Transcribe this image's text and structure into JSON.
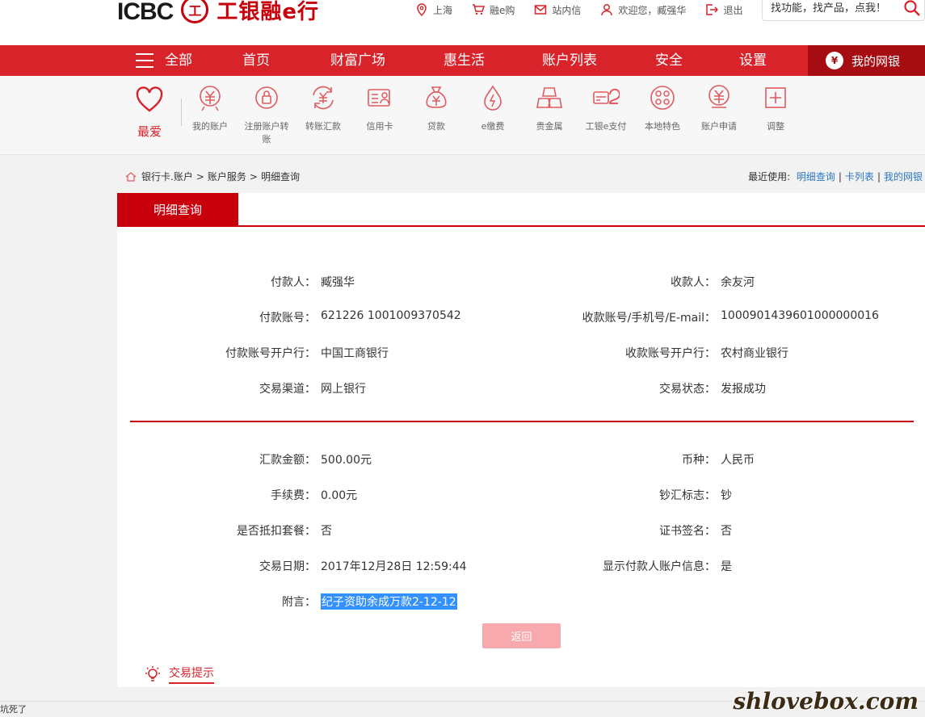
{
  "header": {
    "logo_text": "ICBC",
    "logo_seal": "工",
    "logo_cn": "工银融e行",
    "links": [
      {
        "label": "上海",
        "icon": "location-pin-icon"
      },
      {
        "label": "融e购",
        "icon": "cart-icon"
      },
      {
        "label": "站内信",
        "icon": "mail-icon"
      },
      {
        "label": "欢迎您，臧强华",
        "icon": "user-icon"
      },
      {
        "label": "退出",
        "icon": "logout-icon"
      }
    ],
    "search_placeholder": "找功能，找产品，点我！"
  },
  "nav": {
    "all_label": "全部",
    "items": [
      "首页",
      "财富广场",
      "惠生活",
      "账户列表",
      "安全",
      "设置"
    ],
    "mybank_label": "我的网银"
  },
  "quickbar": {
    "favorite_label": "最爱",
    "items": [
      {
        "label": "我的账户",
        "icon": "yen-circle-icon"
      },
      {
        "label": "注册账户转账",
        "icon": "lock-circle-icon"
      },
      {
        "label": "转账汇款",
        "icon": "transfer-icon"
      },
      {
        "label": "信用卡",
        "icon": "credit-card-icon"
      },
      {
        "label": "贷款",
        "icon": "money-bag-icon"
      },
      {
        "label": "e缴费",
        "icon": "flame-drop-icon"
      },
      {
        "label": "贵金属",
        "icon": "gold-bars-icon"
      },
      {
        "label": "工银e支付",
        "icon": "e-pay-icon"
      },
      {
        "label": "本地特色",
        "icon": "local-icon"
      },
      {
        "label": "账户申请",
        "icon": "apply-icon"
      },
      {
        "label": "调整",
        "icon": "plus-box-icon"
      }
    ]
  },
  "breadcrumb": {
    "items": [
      "银行卡.账户",
      "账户服务",
      "明细查询"
    ],
    "sep": ">"
  },
  "recent": {
    "label": "最近使用:",
    "links": [
      "明细查询",
      "卡列表",
      "我的网银"
    ]
  },
  "tab": {
    "active_label": "明细查询"
  },
  "details": {
    "payer_label": "付款人：",
    "payer": "臧强华",
    "payee_label": "收款人：",
    "payee": "余友河",
    "payer_acct_label": "付款账号：",
    "payer_acct": "621226 1001009370542",
    "payee_acct_label": "收款账号/手机号/E-mail：",
    "payee_acct": "1000901439601000000016",
    "payer_bank_label": "付款账号开户行：",
    "payer_bank": "中国工商银行",
    "payee_bank_label": "收款账号开户行：",
    "payee_bank": "农村商业银行",
    "channel_label": "交易渠道：",
    "channel": "网上银行",
    "status_label": "交易状态：",
    "status": "发报成功",
    "amount_label": "汇款金额：",
    "amount": "500.00元",
    "currency_label": "币种：",
    "currency": "人民币",
    "fee_label": "手续费：",
    "fee": "0.00元",
    "cash_flag_label": "钞汇标志：",
    "cash_flag": "钞",
    "package_label": "是否抵扣套餐：",
    "package": "否",
    "cert_label": "证书签名：",
    "cert": "否",
    "date_label": "交易日期：",
    "date": "2017年12月28日 12:59:44",
    "show_payer_label": "显示付款人账户信息：",
    "show_payer": "是",
    "memo_label": "附言：",
    "memo": "纪子资助余成万款2-12-12"
  },
  "back_button": "返回",
  "tips_label": "交易提示",
  "status_text": "坑死了",
  "watermark": "shlovebox.com"
}
